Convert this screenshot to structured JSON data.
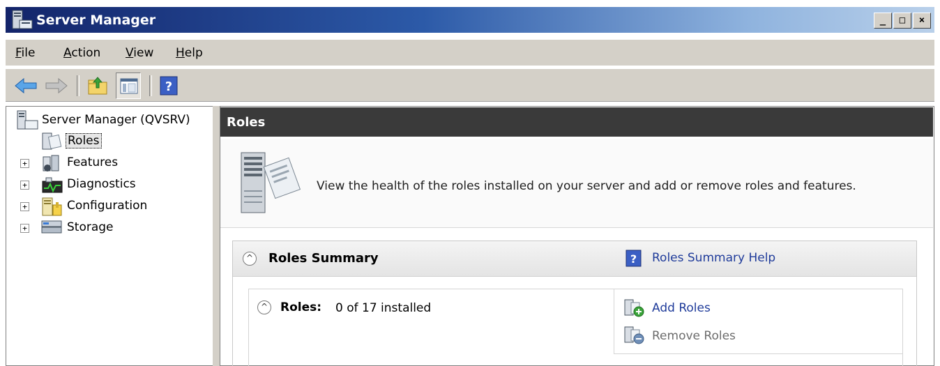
{
  "window": {
    "title": "Server Manager",
    "buttons": {
      "minimize": "_",
      "maximize": "□",
      "close": "×"
    }
  },
  "menubar": {
    "items": [
      {
        "label": "File",
        "mnemonic": "F",
        "rest": "ile"
      },
      {
        "label": "Action",
        "mnemonic": "A",
        "rest": "ction"
      },
      {
        "label": "View",
        "mnemonic": "V",
        "rest": "iew"
      },
      {
        "label": "Help",
        "mnemonic": "H",
        "rest": "elp"
      }
    ]
  },
  "toolbar": {
    "icons": [
      "back-arrow-icon",
      "forward-arrow-icon",
      "up-folder-icon",
      "show-hide-tree-icon",
      "help-icon"
    ]
  },
  "tree": {
    "root": "Server Manager (QVSRV)",
    "items": [
      {
        "label": "Roles",
        "expandable": false,
        "selected": true,
        "icon": "roles-icon"
      },
      {
        "label": "Features",
        "expandable": true,
        "icon": "features-icon"
      },
      {
        "label": "Diagnostics",
        "expandable": true,
        "icon": "diagnostics-icon"
      },
      {
        "label": "Configuration",
        "expandable": true,
        "icon": "configuration-icon"
      },
      {
        "label": "Storage",
        "expandable": true,
        "icon": "storage-icon"
      }
    ],
    "expander_glyph": "+"
  },
  "main": {
    "header": "Roles",
    "description": "View the health of the roles installed on your server and add or remove roles and features.",
    "summary": {
      "title": "Roles Summary",
      "help_link": "Roles Summary Help",
      "collapse_glyph": "^"
    },
    "roles": {
      "label": "Roles:",
      "count": "0 of 17 installed",
      "add": "Add Roles",
      "remove": "Remove Roles"
    }
  },
  "colors": {
    "title_gradient_start": "#13246a",
    "title_gradient_end": "#b9d0ea",
    "chrome": "#d4d0c8",
    "header_bar": "#3a3a3a",
    "link": "#1f3b9a",
    "disabled_link": "#6c6c6c"
  }
}
